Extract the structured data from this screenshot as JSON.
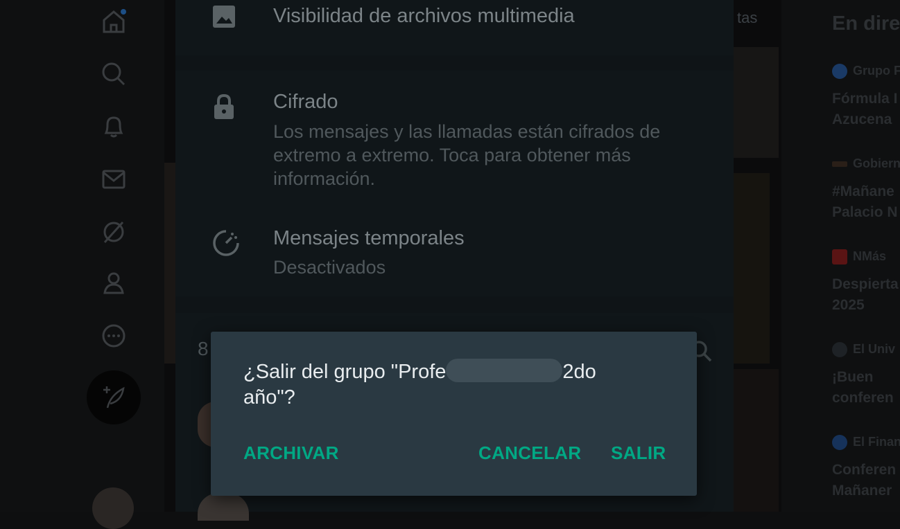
{
  "whatsapp": {
    "media_visibility": {
      "title": "Visibilidad de archivos multimedia",
      "icon": "image-icon"
    },
    "encryption": {
      "title": "Cifrado",
      "subtitle_lines": [
        "Los mensajes y las llamadas están cifrados de",
        "extremo a extremo. Toca para obtener más",
        "información."
      ],
      "icon": "lock-icon"
    },
    "disappearing": {
      "title": "Mensajes temporales",
      "subtitle": "Desactivados",
      "icon": "timer-icon"
    },
    "members_count_partial": "8",
    "dialog": {
      "message_part1": "¿Salir del grupo \"Profe",
      "message_part2": "2do",
      "message_part3": "año\"?",
      "archive_label": "ARCHIVAR",
      "cancel_label": "CANCELAR",
      "leave_label": "SALIR"
    }
  },
  "background": {
    "tab_hint": "tas",
    "right_title": "En dire",
    "trends": [
      {
        "source": "Grupo F",
        "text_lines": [
          "Fórmula I",
          "Azucena"
        ]
      },
      {
        "source": "Gobiern",
        "text_lines": [
          "#Mañane",
          "Palacio N"
        ]
      },
      {
        "source": "NMás",
        "text_lines": [
          "Despierta",
          "2025"
        ]
      },
      {
        "source": "El Univ",
        "text_lines": [
          "¡Buen",
          "conferen"
        ]
      },
      {
        "source": "El Finan",
        "text_lines": [
          "Conferen",
          "Mañaner"
        ]
      }
    ]
  },
  "colors": {
    "accent": "#00a884",
    "dialog_bg": "#2a3942",
    "dialog_text": "#e9edef"
  }
}
